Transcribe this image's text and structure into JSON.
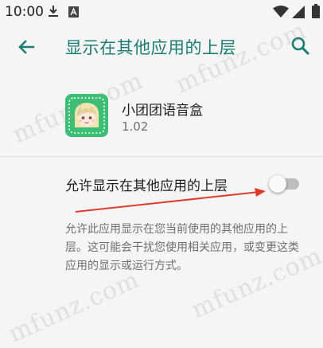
{
  "status_bar": {
    "time": "10:00",
    "icons": [
      "download-icon",
      "a-icon",
      "wifi-icon",
      "signal-icon",
      "battery-icon"
    ]
  },
  "app_bar": {
    "title": "显示在其他应用的上层",
    "back_icon": "back-arrow-icon",
    "search_icon": "search-icon",
    "accent_color": "#1a7d72"
  },
  "app_info": {
    "name": "小团团语音盒",
    "version": "1.02",
    "icon": "app-icon"
  },
  "permission": {
    "label": "允许显示在其他应用的上层",
    "enabled": false
  },
  "description": "允许此应用显示在您当前使用的其他应用的上层。这可能会干扰您使用相关应用，或变更这类应用的显示或运行方式。",
  "watermark_text": "mfunz.com",
  "annotation_color": "#e03a2a"
}
